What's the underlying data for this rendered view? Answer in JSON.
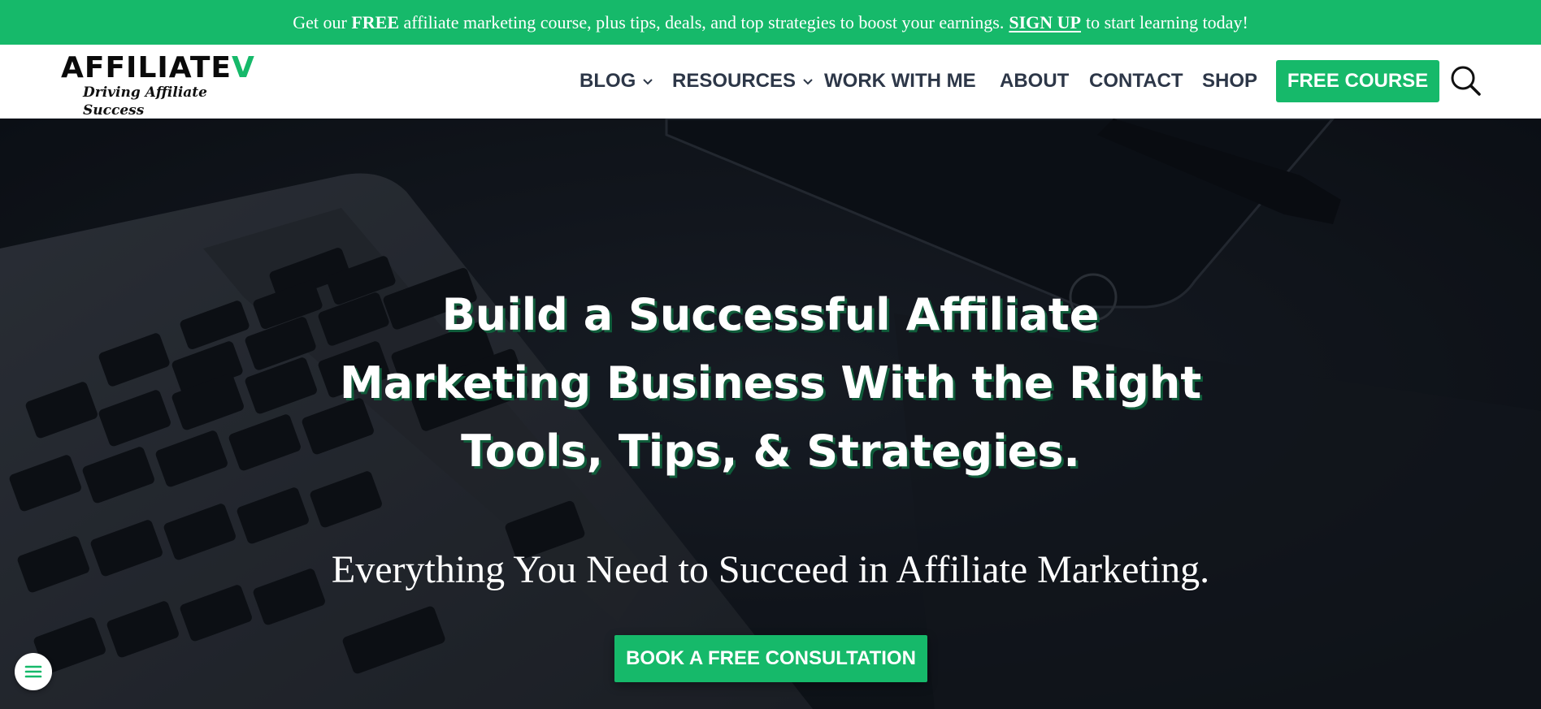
{
  "announcement": {
    "text_before": "Get our",
    "bold_free": "FREE",
    "text_middle": "affiliate marketing course, plus tips, deals, and top strategies to boost your earnings.",
    "signup_link": "SIGN UP",
    "text_after": "to start learning today!"
  },
  "logo": {
    "word_main": "AFFILIATE",
    "word_accent": "V",
    "tagline": "Driving Affiliate Success"
  },
  "nav": {
    "items": [
      {
        "label": "BLOG",
        "has_dropdown": true
      },
      {
        "label": "RESOURCES",
        "has_dropdown": true
      },
      {
        "label": "WORK WITH ME",
        "has_dropdown": false
      },
      {
        "label": "ABOUT",
        "has_dropdown": false
      },
      {
        "label": "CONTACT",
        "has_dropdown": false
      },
      {
        "label": "SHOP",
        "has_dropdown": false
      }
    ],
    "cta_label": "FREE COURSE",
    "search_icon": "search-icon"
  },
  "hero": {
    "title_line1": "Build a Successful Affiliate",
    "title_line2": "Marketing Business With the Right",
    "title_line3": "Tools, Tips, & Strategies.",
    "subtitle": "Everything You Need to Succeed in Affiliate Marketing.",
    "cta_label": "BOOK A FREE CONSULTATION"
  },
  "colors": {
    "brand_green": "#16b96a",
    "nav_text": "#2d3748",
    "hero_overlay": "#11161e"
  },
  "floating_menu_icon": "hamburger-icon"
}
